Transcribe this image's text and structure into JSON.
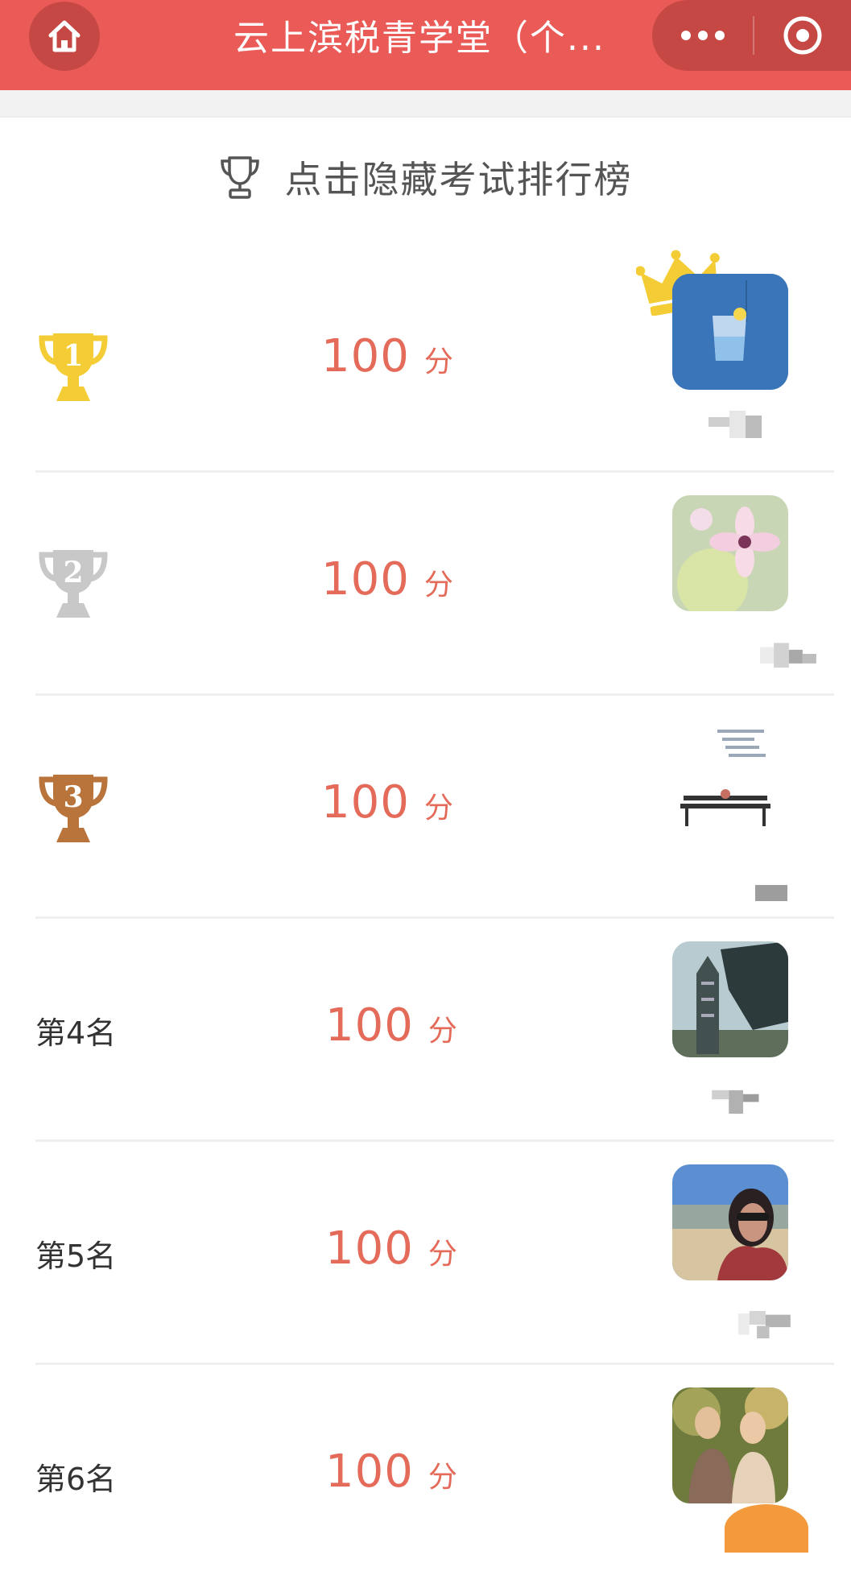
{
  "titlebar": {
    "title": "云上滨税青学堂（个...",
    "home_icon": "home-icon",
    "more_icon": "more-dots-icon",
    "close_icon": "target-close-icon",
    "bg_color": "#ea5b58"
  },
  "leaderboard": {
    "toggle_label": "点击隐藏考试排行榜",
    "toggle_icon": "trophy-outline-icon",
    "unit": "分",
    "rows": [
      {
        "rank": 1,
        "rank_label": "",
        "medal": "gold",
        "score": "100"
      },
      {
        "rank": 2,
        "rank_label": "",
        "medal": "silver",
        "score": "100"
      },
      {
        "rank": 3,
        "rank_label": "",
        "medal": "bronze",
        "score": "100"
      },
      {
        "rank": 4,
        "rank_label": "第4名",
        "medal": "",
        "score": "100"
      },
      {
        "rank": 5,
        "rank_label": "第5名",
        "medal": "",
        "score": "100"
      },
      {
        "rank": 6,
        "rank_label": "第6名",
        "medal": "",
        "score": "100"
      }
    ],
    "medal_colors": {
      "gold": "#f4cd36",
      "silver": "#c8c8c8",
      "bronze": "#b9743c"
    },
    "score_color": "#e46b5a"
  }
}
